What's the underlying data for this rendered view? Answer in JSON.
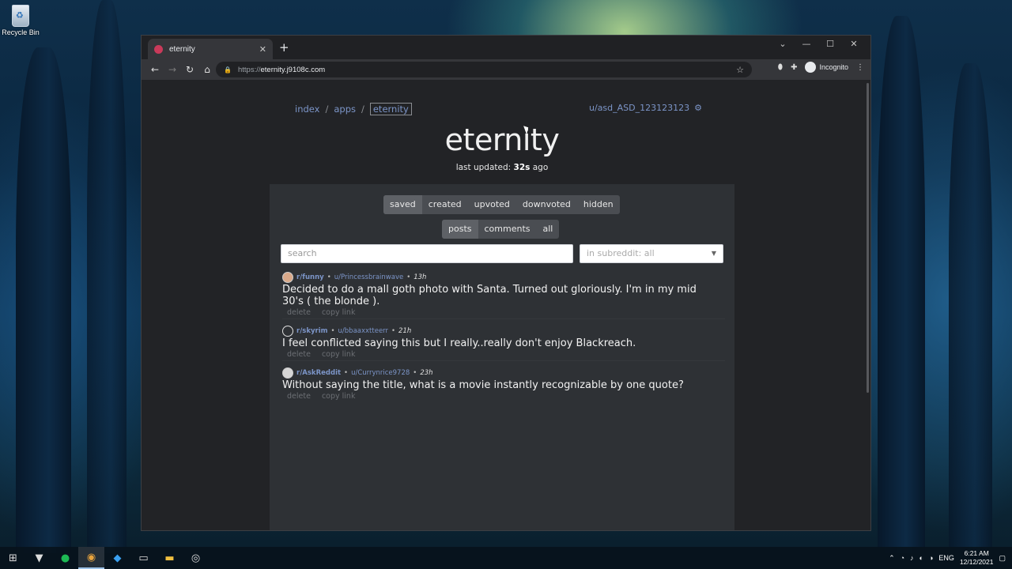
{
  "desktop": {
    "recycle_bin_label": "Recycle Bin"
  },
  "browser": {
    "tab_title": "eternity",
    "url_scheme": "https://",
    "url_host": "eternity.j9108c.com",
    "profile_label": "Incognito"
  },
  "page": {
    "breadcrumb": [
      "index",
      "apps",
      "eternity"
    ],
    "breadcrumb_sep": "/",
    "username": "u/asd_ASD_123123123",
    "title": "eternity",
    "updated_prefix": "last updated:",
    "updated_value": "32s",
    "updated_suffix": "ago"
  },
  "filters": {
    "categories": [
      "saved",
      "created",
      "upvoted",
      "downvoted",
      "hidden"
    ],
    "active_category": "saved",
    "types": [
      "posts",
      "comments",
      "all"
    ],
    "active_type": "posts",
    "search_placeholder": "search",
    "subreddit_select": "in subreddit: all"
  },
  "posts": [
    {
      "subreddit": "r/funny",
      "author": "u/Princessbrainwave",
      "time": "13h",
      "title": "Decided to do a mall goth photo with Santa. Turned out gloriously. I'm in my mid 30's ( the blonde ).",
      "delete": "delete",
      "copy_link": "copy link"
    },
    {
      "subreddit": "r/skyrim",
      "author": "u/bbaaxxtteerr",
      "time": "21h",
      "title": "I feel conflicted saying this but I really..really don't enjoy Blackreach.",
      "delete": "delete",
      "copy_link": "copy link"
    },
    {
      "subreddit": "r/AskReddit",
      "author": "u/Currynrice9728",
      "time": "23h",
      "title": "Without saying the title, what is a movie instantly recognizable by one quote?",
      "delete": "delete",
      "copy_link": "copy link"
    }
  ],
  "taskbar": {
    "language": "ENG",
    "time": "6:21 AM",
    "date": "12/12/2021"
  }
}
